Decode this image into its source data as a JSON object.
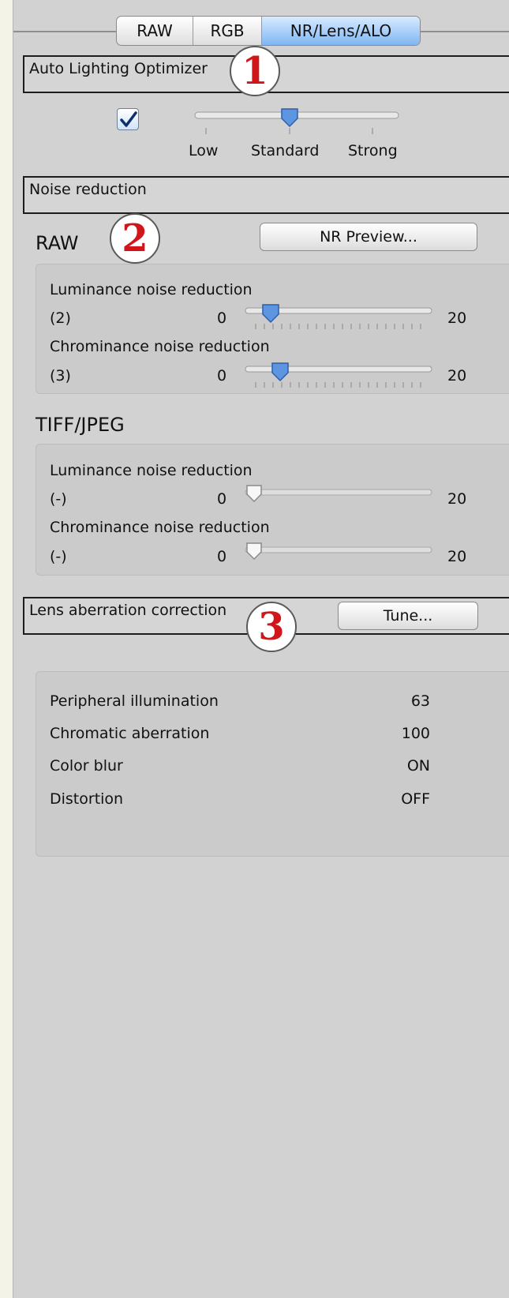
{
  "tabs": [
    "RAW",
    "RGB",
    "NR/Lens/ALO"
  ],
  "active_tab": "NR/Lens/ALO",
  "alo": {
    "title": "Auto Lighting Optimizer",
    "marker": "1",
    "enabled": true,
    "slider_labels": [
      "Low",
      "Standard",
      "Strong"
    ],
    "level": "Standard"
  },
  "noise": {
    "title": "Noise reduction",
    "marker": "2",
    "raw_title": "RAW",
    "preview_button": "NR Preview...",
    "raw_rows": [
      {
        "label": "Luminance noise reduction",
        "value": "(2)",
        "min": "0",
        "max": "20",
        "position": 2
      },
      {
        "label": "Chrominance noise reduction",
        "value": "(3)",
        "min": "0",
        "max": "20",
        "position": 3
      }
    ],
    "tiff_title": "TIFF/JPEG",
    "tiff_rows": [
      {
        "label": "Luminance noise reduction",
        "value": "(-)",
        "min": "0",
        "max": "20",
        "position": 0
      },
      {
        "label": "Chrominance noise reduction",
        "value": "(-)",
        "min": "0",
        "max": "20",
        "position": 0
      }
    ]
  },
  "lens": {
    "title": "Lens aberration correction",
    "marker": "3",
    "tune_button": "Tune...",
    "items": [
      {
        "label": "Peripheral illumination",
        "value": "63"
      },
      {
        "label": "Chromatic aberration",
        "value": "100"
      },
      {
        "label": "Color blur",
        "value": "ON"
      },
      {
        "label": "Distortion",
        "value": "OFF"
      }
    ]
  },
  "colors": {
    "marker_number": "#d0161b",
    "accent": "#4a86d8",
    "panel": "#d2d2d2"
  }
}
